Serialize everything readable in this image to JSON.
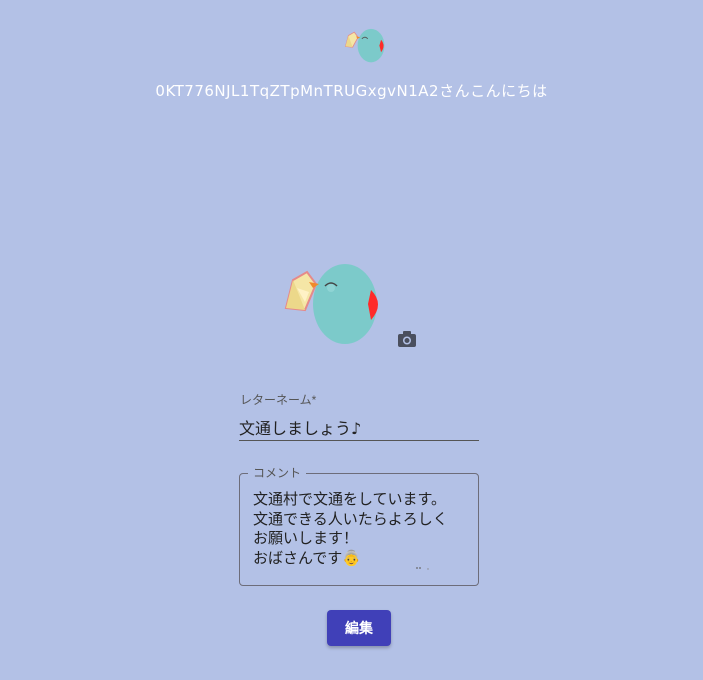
{
  "header": {
    "greeting": "0KT776NJL1TqZTpMnTRUGxgvN1A2さんこんにちは"
  },
  "profile": {
    "avatar_icon": "bird-with-letter-icon",
    "camera_icon": "camera-icon"
  },
  "form": {
    "letter_name_label": "レターネーム*",
    "letter_name_value": "文通しましょう♪",
    "comment_label": "コメント",
    "comment_value": "文通村で文通をしています。\n文通できる人いたらよろしく\nお願いします！\nおばさんです👵"
  },
  "actions": {
    "edit_label": "編集"
  },
  "colors": {
    "background": "#b3c1e6",
    "button": "#4040b8",
    "bird_body": "#7ccaca",
    "bird_beak": "#ff2a2a",
    "envelope": "#f5e6a6"
  }
}
